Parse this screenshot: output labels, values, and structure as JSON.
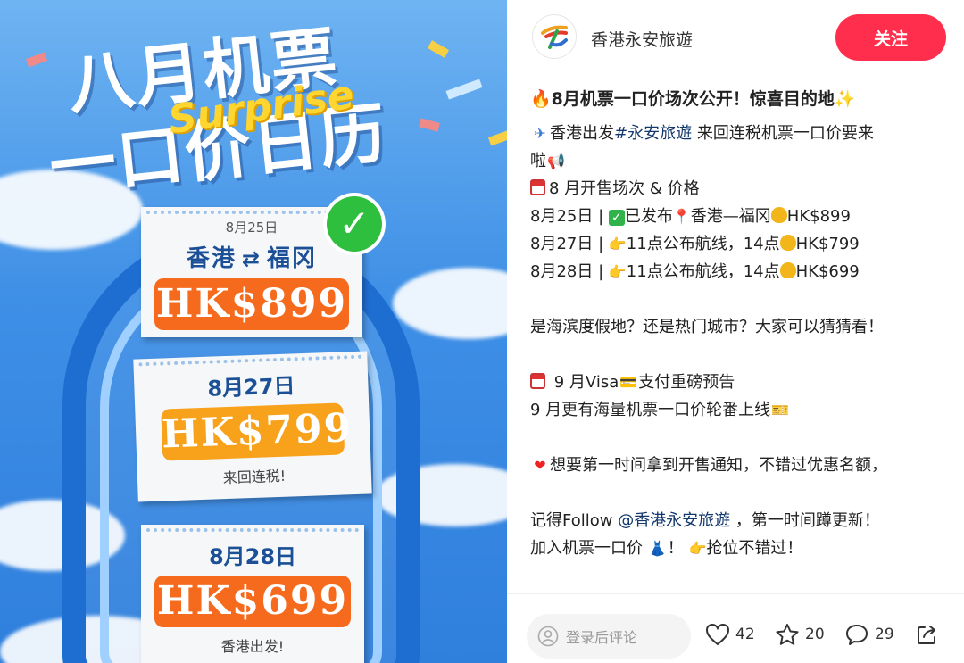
{
  "poster": {
    "title_line1": "八月机票",
    "title_line2": "一口价日历",
    "surprise": "Surprise",
    "ticket1": {
      "date": "8月25日",
      "from": "香港",
      "to": "福冈",
      "price": "HK$899"
    },
    "ticket2": {
      "date": "8月27日",
      "price": "HK$799",
      "note": "来回连税!"
    },
    "ticket3": {
      "date": "8月28日",
      "price": "HK$699",
      "note": "香港出发!"
    }
  },
  "header": {
    "author": "香港永安旅遊",
    "follow_label": "关注"
  },
  "post": {
    "title": "🔥8月机票一口价场次公开！惊喜目的地✨",
    "line1_prefix": "香港出发",
    "line1_tag": "#永安旅遊",
    "line1_suffix": " 来回连税机票一口价要来",
    "line1_cont": "啦",
    "line2": "8 月开售场次 & 价格",
    "row1": {
      "date": "8月25日",
      "status": "已发布",
      "route": "香港—福冈",
      "price": "HK$899"
    },
    "row2": {
      "date": "8月27日",
      "status": "11点公布航线，14点",
      "price": "HK$799"
    },
    "row3": {
      "date": "8月28日",
      "status": "11点公布航线，14点",
      "price": "HK$699"
    },
    "question": "是海滨度假地？还是热门城市？大家可以猜猜看！",
    "visa_line": " 9 月Visa",
    "visa_suffix": "支付重磅预告",
    "sep_line": "9 月更有海量机票一口价轮番上线",
    "notify": "想要第一时间拿到开售通知，不错过优惠名额，",
    "follow_prefix": "记得Follow ",
    "follow_tag": "@香港永安旅遊",
    "follow_suffix": " ，第一时间蹲更新！",
    "join_prefix": "加入机票一口价 ",
    "join_suffix": "抢位不错过！"
  },
  "footer": {
    "comment_placeholder": "登录后评论",
    "likes": "42",
    "stars": "20",
    "comments": "29"
  },
  "colors": {
    "follow": "#ff2e4d",
    "sky": "#3e8fe6",
    "orange": "#f56a1c",
    "amber": "#f8a21b"
  }
}
